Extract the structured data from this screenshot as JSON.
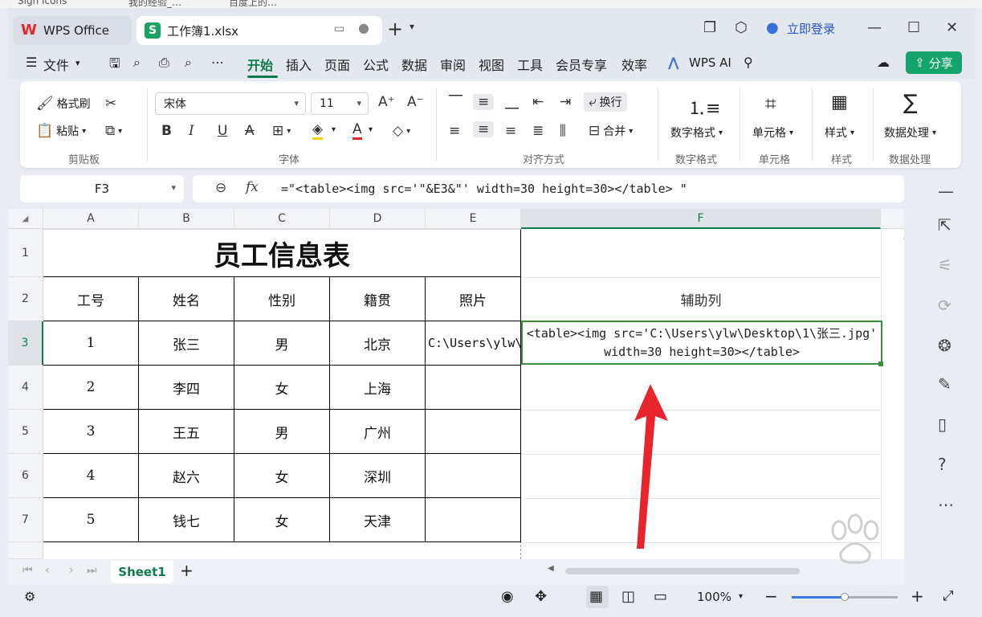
{
  "bookmarks": [
    "Sign Icons",
    "我的经验_…",
    "百度上的…"
  ],
  "tabs": [
    {
      "label": "WPS Office"
    },
    {
      "label": "工作簿1.xlsx"
    }
  ],
  "window": {
    "login": "立即登录"
  },
  "menu": {
    "file": "文件",
    "items": [
      "开始",
      "插入",
      "页面",
      "公式",
      "数据",
      "审阅",
      "视图",
      "工具",
      "会员专享",
      "效率"
    ],
    "active": "开始",
    "ai": "WPS AI",
    "share": "分享"
  },
  "ribbon": {
    "clipboard": {
      "format_painter": "格式刷",
      "paste": "粘贴",
      "group": "剪贴板"
    },
    "font": {
      "name": "宋体",
      "size": "11",
      "group": "字体"
    },
    "align": {
      "wrap": "换行",
      "merge": "合并",
      "group": "对齐方式"
    },
    "number": {
      "label": "数字格式",
      "group": "数字格式"
    },
    "cell": {
      "label": "单元格",
      "group": "单元格"
    },
    "style": {
      "label": "样式",
      "group": "样式"
    },
    "data": {
      "label": "数据处理",
      "group": "数据处理"
    }
  },
  "formula": {
    "namebox": "F3",
    "fx": "fx",
    "text": "=\"<table><img src='\"&E3&\"' width=30 height=30></table> \""
  },
  "grid": {
    "columns": [
      "A",
      "B",
      "C",
      "D",
      "E",
      "F"
    ],
    "selected_column": "F",
    "rows": [
      "1",
      "2",
      "3",
      "4",
      "5",
      "6",
      "7"
    ],
    "selected_row": "3",
    "title": "员工信息表",
    "headers": [
      "工号",
      "姓名",
      "性别",
      "籍贯",
      "照片",
      "辅助列"
    ],
    "data": [
      [
        "1",
        "张三",
        "男",
        "北京",
        "C:\\Users\\ylw\\"
      ],
      [
        "2",
        "李四",
        "女",
        "上海",
        ""
      ],
      [
        "3",
        "王五",
        "男",
        "广州",
        ""
      ],
      [
        "4",
        "赵六",
        "女",
        "深圳",
        ""
      ],
      [
        "5",
        "钱七",
        "女",
        "天津",
        ""
      ]
    ],
    "f3_line1": "<table><img src='C:\\Users\\ylw\\Desktop\\1\\张三.jpg'",
    "f3_line2": "width=30 height=30></table>"
  },
  "sheets": {
    "active": "Sheet1"
  },
  "status": {
    "zoom": "100%",
    "zoom_level": 0.5
  },
  "colors": {
    "accent": "#0f7a4a",
    "share": "#14a36a",
    "selection": "#3c8f3c",
    "arrow": "#e8242c"
  }
}
